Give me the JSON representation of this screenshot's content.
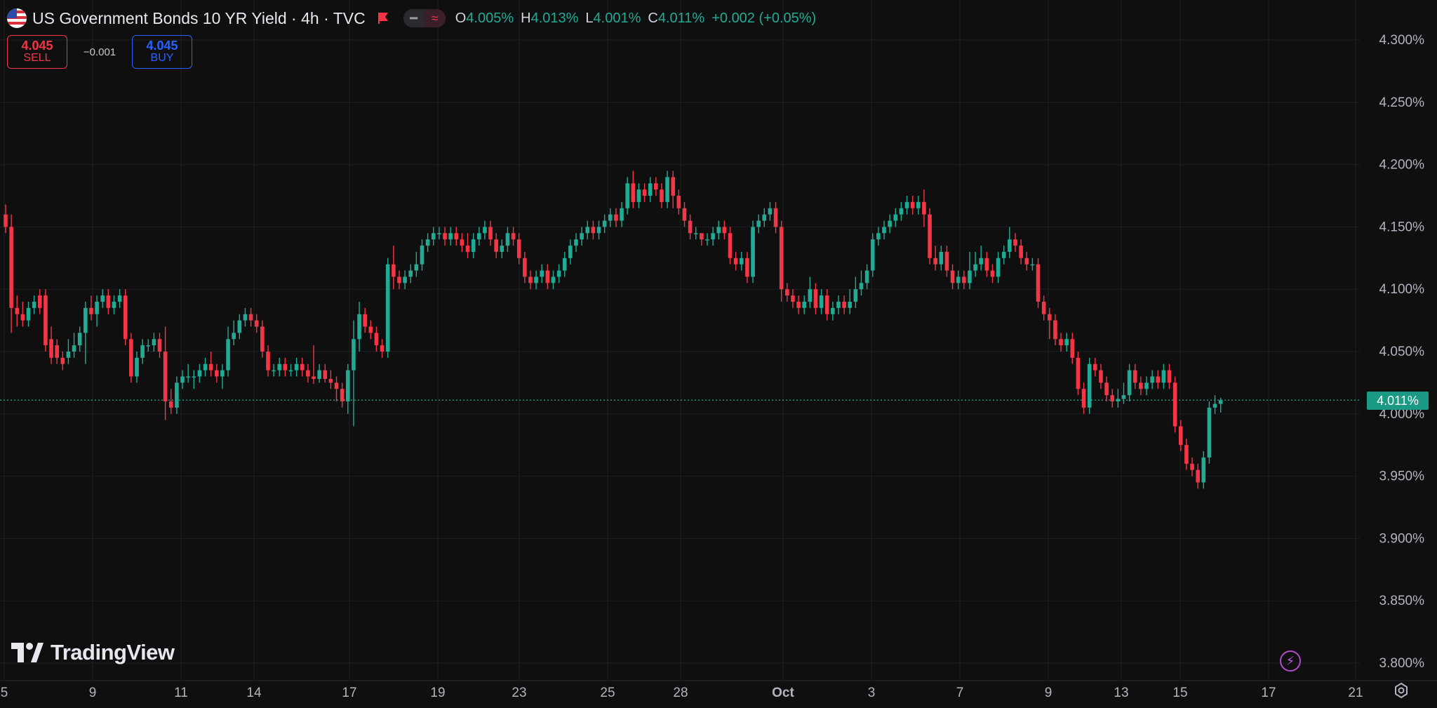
{
  "header": {
    "title": "US Government Bonds 10 YR Yield · 4h · TVC",
    "flag_icon": "us-flag-icon",
    "ohlc": {
      "open_label": "O",
      "open_value": "4.005%",
      "high_label": "H",
      "high_value": "4.013%",
      "low_label": "L",
      "low_value": "4.001%",
      "close_label": "C",
      "close_value": "4.011%",
      "change": "+0.002 (+0.05%)"
    }
  },
  "trade": {
    "sell_price": "4.045",
    "sell_label": "SELL",
    "spread": "−0.001",
    "buy_price": "4.045",
    "buy_label": "BUY"
  },
  "logo": {
    "text": "TradingView"
  },
  "colors": {
    "up": "#22ab94",
    "down": "#f23645",
    "grid": "#1e1f22",
    "background": "#0f0f10",
    "axis_text": "#b2b5be",
    "last_price_line": "#22ab94"
  },
  "chart_data": {
    "type": "candlestick",
    "title": "US Government Bonds 10 YR Yield · 4h · TVC",
    "y_ticks": [
      "4.300%",
      "4.250%",
      "4.200%",
      "4.150%",
      "4.100%",
      "4.050%",
      "4.000%",
      "3.950%",
      "3.900%",
      "3.850%",
      "3.800%"
    ],
    "y_tick_values": [
      4.3,
      4.25,
      4.2,
      4.15,
      4.1,
      4.05,
      4.0,
      3.95,
      3.9,
      3.85,
      3.8
    ],
    "ylim": [
      3.8,
      4.3
    ],
    "x_tick_labels": [
      "5",
      "9",
      "11",
      "14",
      "17",
      "19",
      "23",
      "25",
      "28",
      "Oct",
      "3",
      "7",
      "9",
      "13",
      "15",
      "17",
      "21"
    ],
    "last_price": 4.011,
    "last_price_label": "4.011%",
    "grid": true,
    "candles": [
      [
        4.16,
        4.15,
        4.168,
        4.145
      ],
      [
        4.15,
        4.085,
        4.16,
        4.065
      ],
      [
        4.085,
        4.08,
        4.095,
        4.07
      ],
      [
        4.08,
        4.075,
        4.09,
        4.07
      ],
      [
        4.075,
        4.085,
        4.09,
        4.07
      ],
      [
        4.085,
        4.09,
        4.095,
        4.08
      ],
      [
        4.095,
        4.085,
        4.1,
        4.08
      ],
      [
        4.095,
        4.055,
        4.1,
        4.05
      ],
      [
        4.06,
        4.045,
        4.07,
        4.04
      ],
      [
        4.055,
        4.045,
        4.06,
        4.04
      ],
      [
        4.045,
        4.04,
        4.05,
        4.035
      ],
      [
        4.045,
        4.05,
        4.06,
        4.04
      ],
      [
        4.05,
        4.055,
        4.065,
        4.045
      ],
      [
        4.055,
        4.065,
        4.07,
        4.05
      ],
      [
        4.065,
        4.085,
        4.09,
        4.04
      ],
      [
        4.085,
        4.08,
        4.095,
        4.075
      ],
      [
        4.08,
        4.09,
        4.095,
        4.07
      ],
      [
        4.09,
        4.095,
        4.1,
        4.085
      ],
      [
        4.095,
        4.085,
        4.1,
        4.08
      ],
      [
        4.085,
        4.09,
        4.095,
        4.08
      ],
      [
        4.09,
        4.095,
        4.1,
        4.085
      ],
      [
        4.095,
        4.06,
        4.1,
        4.055
      ],
      [
        4.06,
        4.03,
        4.065,
        4.025
      ],
      [
        4.03,
        4.045,
        4.05,
        4.025
      ],
      [
        4.045,
        4.055,
        4.06,
        4.04
      ],
      [
        4.055,
        4.055,
        4.06,
        4.05
      ],
      [
        4.055,
        4.06,
        4.065,
        4.05
      ],
      [
        4.06,
        4.05,
        4.065,
        4.045
      ],
      [
        4.05,
        4.01,
        4.07,
        3.995
      ],
      [
        4.01,
        4.005,
        4.02,
        4.0
      ],
      [
        4.005,
        4.025,
        4.03,
        4.0
      ],
      [
        4.025,
        4.03,
        4.035,
        4.02
      ],
      [
        4.03,
        4.03,
        4.04,
        4.025
      ],
      [
        4.03,
        4.03,
        4.035,
        4.02
      ],
      [
        4.03,
        4.035,
        4.04,
        4.025
      ],
      [
        4.035,
        4.04,
        4.045,
        4.03
      ],
      [
        4.04,
        4.035,
        4.05,
        4.03
      ],
      [
        4.035,
        4.03,
        4.04,
        4.025
      ],
      [
        4.03,
        4.035,
        4.04,
        4.02
      ],
      [
        4.035,
        4.06,
        4.07,
        4.03
      ],
      [
        4.06,
        4.065,
        4.075,
        4.055
      ],
      [
        4.065,
        4.075,
        4.08,
        4.06
      ],
      [
        4.075,
        4.08,
        4.085,
        4.07
      ],
      [
        4.08,
        4.075,
        4.085,
        4.07
      ],
      [
        4.075,
        4.07,
        4.08,
        4.065
      ],
      [
        4.07,
        4.05,
        4.075,
        4.045
      ],
      [
        4.05,
        4.035,
        4.055,
        4.03
      ],
      [
        4.035,
        4.035,
        4.04,
        4.03
      ],
      [
        4.035,
        4.04,
        4.045,
        4.03
      ],
      [
        4.04,
        4.035,
        4.045,
        4.03
      ],
      [
        4.035,
        4.035,
        4.04,
        4.03
      ],
      [
        4.035,
        4.04,
        4.045,
        4.03
      ],
      [
        4.04,
        4.035,
        4.045,
        4.03
      ],
      [
        4.035,
        4.03,
        4.04,
        4.025
      ],
      [
        4.03,
        4.028,
        4.055,
        4.024
      ],
      [
        4.028,
        4.035,
        4.04,
        4.025
      ],
      [
        4.035,
        4.028,
        4.04,
        4.025
      ],
      [
        4.028,
        4.025,
        4.035,
        4.02
      ],
      [
        4.025,
        4.02,
        4.03,
        4.01
      ],
      [
        4.02,
        4.01,
        4.025,
        4.005
      ],
      [
        4.01,
        4.035,
        4.04,
        4.0
      ],
      [
        4.035,
        4.06,
        4.075,
        3.99
      ],
      [
        4.06,
        4.08,
        4.09,
        4.05
      ],
      [
        4.08,
        4.07,
        4.085,
        4.065
      ],
      [
        4.07,
        4.065,
        4.075,
        4.06
      ],
      [
        4.065,
        4.055,
        4.07,
        4.05
      ],
      [
        4.055,
        4.05,
        4.06,
        4.045
      ],
      [
        4.05,
        4.12,
        4.125,
        4.045
      ],
      [
        4.12,
        4.11,
        4.135,
        4.1
      ],
      [
        4.11,
        4.105,
        4.115,
        4.1
      ],
      [
        4.105,
        4.11,
        4.115,
        4.1
      ],
      [
        4.11,
        4.115,
        4.12,
        4.105
      ],
      [
        4.115,
        4.12,
        4.13,
        4.11
      ],
      [
        4.12,
        4.135,
        4.14,
        4.115
      ],
      [
        4.135,
        4.14,
        4.145,
        4.13
      ],
      [
        4.14,
        4.145,
        4.15,
        4.135
      ],
      [
        4.145,
        4.145,
        4.15,
        4.14
      ],
      [
        4.145,
        4.14,
        4.15,
        4.135
      ],
      [
        4.14,
        4.145,
        4.15,
        4.135
      ],
      [
        4.145,
        4.14,
        4.15,
        4.135
      ],
      [
        4.14,
        4.135,
        4.145,
        4.13
      ],
      [
        4.135,
        4.13,
        4.145,
        4.125
      ],
      [
        4.13,
        4.14,
        4.145,
        4.125
      ],
      [
        4.14,
        4.145,
        4.15,
        4.135
      ],
      [
        4.145,
        4.15,
        4.155,
        4.14
      ],
      [
        4.15,
        4.14,
        4.155,
        4.135
      ],
      [
        4.14,
        4.13,
        4.145,
        4.125
      ],
      [
        4.13,
        4.135,
        4.14,
        4.125
      ],
      [
        4.135,
        4.145,
        4.15,
        4.13
      ],
      [
        4.145,
        4.14,
        4.15,
        4.135
      ],
      [
        4.14,
        4.125,
        4.145,
        4.12
      ],
      [
        4.125,
        4.11,
        4.13,
        4.105
      ],
      [
        4.11,
        4.105,
        4.115,
        4.1
      ],
      [
        4.105,
        4.11,
        4.115,
        4.1
      ],
      [
        4.11,
        4.115,
        4.12,
        4.105
      ],
      [
        4.115,
        4.105,
        4.12,
        4.1
      ],
      [
        4.105,
        4.11,
        4.115,
        4.1
      ],
      [
        4.11,
        4.115,
        4.12,
        4.105
      ],
      [
        4.115,
        4.125,
        4.13,
        4.11
      ],
      [
        4.125,
        4.135,
        4.14,
        4.12
      ],
      [
        4.135,
        4.14,
        4.145,
        4.13
      ],
      [
        4.14,
        4.145,
        4.15,
        4.135
      ],
      [
        4.145,
        4.15,
        4.155,
        4.14
      ],
      [
        4.15,
        4.145,
        4.155,
        4.14
      ],
      [
        4.145,
        4.15,
        4.155,
        4.14
      ],
      [
        4.15,
        4.155,
        4.16,
        4.145
      ],
      [
        4.155,
        4.16,
        4.165,
        4.15
      ],
      [
        4.16,
        4.155,
        4.165,
        4.15
      ],
      [
        4.155,
        4.165,
        4.17,
        4.15
      ],
      [
        4.165,
        4.185,
        4.19,
        4.16
      ],
      [
        4.185,
        4.17,
        4.195,
        4.165
      ],
      [
        4.17,
        4.18,
        4.185,
        4.165
      ],
      [
        4.18,
        4.175,
        4.185,
        4.17
      ],
      [
        4.175,
        4.185,
        4.19,
        4.17
      ],
      [
        4.185,
        4.18,
        4.19,
        4.175
      ],
      [
        4.18,
        4.17,
        4.185,
        4.165
      ],
      [
        4.17,
        4.19,
        4.195,
        4.165
      ],
      [
        4.19,
        4.175,
        4.195,
        4.165
      ],
      [
        4.175,
        4.165,
        4.18,
        4.16
      ],
      [
        4.165,
        4.155,
        4.17,
        4.15
      ],
      [
        4.155,
        4.145,
        4.16,
        4.14
      ],
      [
        4.145,
        4.145,
        4.15,
        4.14
      ],
      [
        4.145,
        4.14,
        4.145,
        4.135
      ],
      [
        4.14,
        4.14,
        4.145,
        4.135
      ],
      [
        4.14,
        4.145,
        4.15,
        4.135
      ],
      [
        4.145,
        4.15,
        4.155,
        4.14
      ],
      [
        4.15,
        4.145,
        4.155,
        4.14
      ],
      [
        4.145,
        4.125,
        4.15,
        4.12
      ],
      [
        4.125,
        4.12,
        4.13,
        4.115
      ],
      [
        4.12,
        4.125,
        4.13,
        4.115
      ],
      [
        4.125,
        4.11,
        4.13,
        4.105
      ],
      [
        4.11,
        4.15,
        4.155,
        4.105
      ],
      [
        4.15,
        4.155,
        4.16,
        4.145
      ],
      [
        4.155,
        4.16,
        4.165,
        4.15
      ],
      [
        4.16,
        4.165,
        4.17,
        4.155
      ],
      [
        4.165,
        4.15,
        4.17,
        4.145
      ],
      [
        4.15,
        4.1,
        4.155,
        4.09
      ],
      [
        4.1,
        4.095,
        4.105,
        4.09
      ],
      [
        4.095,
        4.09,
        4.1,
        4.085
      ],
      [
        4.09,
        4.085,
        4.095,
        4.08
      ],
      [
        4.085,
        4.09,
        4.095,
        4.08
      ],
      [
        4.09,
        4.1,
        4.11,
        4.085
      ],
      [
        4.1,
        4.085,
        4.105,
        4.08
      ],
      [
        4.085,
        4.095,
        4.1,
        4.08
      ],
      [
        4.095,
        4.08,
        4.1,
        4.075
      ],
      [
        4.08,
        4.085,
        4.09,
        4.075
      ],
      [
        4.085,
        4.09,
        4.095,
        4.08
      ],
      [
        4.09,
        4.085,
        4.095,
        4.08
      ],
      [
        4.085,
        4.09,
        4.1,
        4.08
      ],
      [
        4.09,
        4.1,
        4.11,
        4.085
      ],
      [
        4.1,
        4.105,
        4.115,
        4.095
      ],
      [
        4.105,
        4.115,
        4.12,
        4.1
      ],
      [
        4.115,
        4.14,
        4.145,
        4.11
      ],
      [
        4.14,
        4.145,
        4.15,
        4.135
      ],
      [
        4.145,
        4.15,
        4.155,
        4.14
      ],
      [
        4.15,
        4.155,
        4.16,
        4.145
      ],
      [
        4.155,
        4.16,
        4.165,
        4.15
      ],
      [
        4.16,
        4.165,
        4.17,
        4.155
      ],
      [
        4.165,
        4.17,
        4.175,
        4.16
      ],
      [
        4.17,
        4.165,
        4.175,
        4.16
      ],
      [
        4.165,
        4.17,
        4.175,
        4.16
      ],
      [
        4.17,
        4.16,
        4.18,
        4.15
      ],
      [
        4.16,
        4.125,
        4.165,
        4.12
      ],
      [
        4.125,
        4.12,
        4.135,
        4.115
      ],
      [
        4.12,
        4.13,
        4.135,
        4.115
      ],
      [
        4.13,
        4.115,
        4.135,
        4.11
      ],
      [
        4.115,
        4.105,
        4.12,
        4.1
      ],
      [
        4.105,
        4.11,
        4.115,
        4.1
      ],
      [
        4.11,
        4.105,
        4.115,
        4.1
      ],
      [
        4.105,
        4.115,
        4.13,
        4.1
      ],
      [
        4.115,
        4.12,
        4.13,
        4.11
      ],
      [
        4.12,
        4.125,
        4.135,
        4.115
      ],
      [
        4.125,
        4.115,
        4.13,
        4.11
      ],
      [
        4.115,
        4.11,
        4.12,
        4.105
      ],
      [
        4.11,
        4.125,
        4.13,
        4.105
      ],
      [
        4.125,
        4.13,
        4.135,
        4.12
      ],
      [
        4.13,
        4.14,
        4.15,
        4.125
      ],
      [
        4.14,
        4.135,
        4.145,
        4.13
      ],
      [
        4.135,
        4.125,
        4.14,
        4.12
      ],
      [
        4.125,
        4.12,
        4.13,
        4.115
      ],
      [
        4.12,
        4.12,
        4.125,
        4.115
      ],
      [
        4.12,
        4.09,
        4.125,
        4.085
      ],
      [
        4.09,
        4.08,
        4.095,
        4.075
      ],
      [
        4.08,
        4.075,
        4.085,
        4.06
      ],
      [
        4.075,
        4.06,
        4.08,
        4.055
      ],
      [
        4.06,
        4.055,
        4.065,
        4.05
      ],
      [
        4.055,
        4.06,
        4.065,
        4.05
      ],
      [
        4.06,
        4.045,
        4.065,
        4.04
      ],
      [
        4.045,
        4.02,
        4.05,
        4.015
      ],
      [
        4.02,
        4.005,
        4.025,
        4.0
      ],
      [
        4.005,
        4.04,
        4.045,
        4.0
      ],
      [
        4.04,
        4.035,
        4.045,
        4.03
      ],
      [
        4.035,
        4.025,
        4.04,
        4.02
      ],
      [
        4.025,
        4.015,
        4.03,
        4.01
      ],
      [
        4.015,
        4.01,
        4.02,
        4.005
      ],
      [
        4.01,
        4.012,
        4.02,
        4.005
      ],
      [
        4.012,
        4.015,
        4.025,
        4.008
      ],
      [
        4.015,
        4.035,
        4.04,
        4.01
      ],
      [
        4.035,
        4.025,
        4.04,
        4.02
      ],
      [
        4.025,
        4.02,
        4.03,
        4.015
      ],
      [
        4.02,
        4.025,
        4.03,
        4.015
      ],
      [
        4.025,
        4.03,
        4.035,
        4.02
      ],
      [
        4.03,
        4.025,
        4.035,
        4.02
      ],
      [
        4.025,
        4.035,
        4.04,
        4.02
      ],
      [
        4.035,
        4.025,
        4.04,
        4.02
      ],
      [
        4.025,
        3.99,
        4.03,
        3.985
      ],
      [
        3.99,
        3.975,
        3.995,
        3.97
      ],
      [
        3.975,
        3.96,
        3.98,
        3.955
      ],
      [
        3.96,
        3.955,
        3.965,
        3.95
      ],
      [
        3.955,
        3.945,
        3.96,
        3.94
      ],
      [
        3.945,
        3.965,
        3.97,
        3.94
      ],
      [
        3.965,
        4.005,
        4.01,
        3.96
      ],
      [
        4.005,
        4.008,
        4.015,
        4.0
      ],
      [
        4.008,
        4.011,
        4.013,
        4.001
      ]
    ]
  }
}
